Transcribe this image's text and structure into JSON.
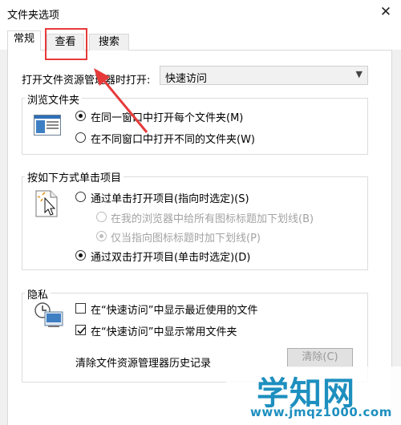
{
  "window": {
    "title": "文件夹选项",
    "close_glyph": "✕"
  },
  "tabs": [
    {
      "label": "常规",
      "active": true
    },
    {
      "label": "查看",
      "active": false
    },
    {
      "label": "搜索",
      "active": false
    }
  ],
  "open_explorer": {
    "label": "打开文件资源管理器时打开:",
    "value": "快速访问"
  },
  "browse_folders": {
    "title": "浏览文件夹",
    "options": [
      {
        "label": "在同一窗口中打开每个文件夹(M)",
        "checked": true
      },
      {
        "label": "在不同窗口中打开不同的文件夹(W)",
        "checked": false
      }
    ]
  },
  "click_items": {
    "title": "按如下方式单击项目",
    "single_click": {
      "label": "通过单击打开项目(指向时选定)(S)",
      "checked": false
    },
    "underline_browser": {
      "label": "在我的浏览器中给所有图标标题加下划线(B)",
      "checked": false,
      "disabled": true
    },
    "underline_hover": {
      "label": "仅当指向图标标题时加下划线(P)",
      "checked": true,
      "disabled": true
    },
    "double_click": {
      "label": "通过双击打开项目(单击时选定)(D)",
      "checked": true
    }
  },
  "privacy": {
    "title": "隐私",
    "recent_files": {
      "label": "在“快速访问”中显示最近使用的文件",
      "checked": false
    },
    "frequent_folders": {
      "label": "在“快速访问”中显示常用文件夹",
      "checked": true
    },
    "clear_history_label": "清除文件资源管理器历史记录",
    "clear_button": "清除(C)"
  },
  "watermark": {
    "main": "学知网",
    "url": "www.jmqz1000.com"
  },
  "colors": {
    "annotation": "#e63a3a",
    "watermark": "#1d8fbf"
  }
}
